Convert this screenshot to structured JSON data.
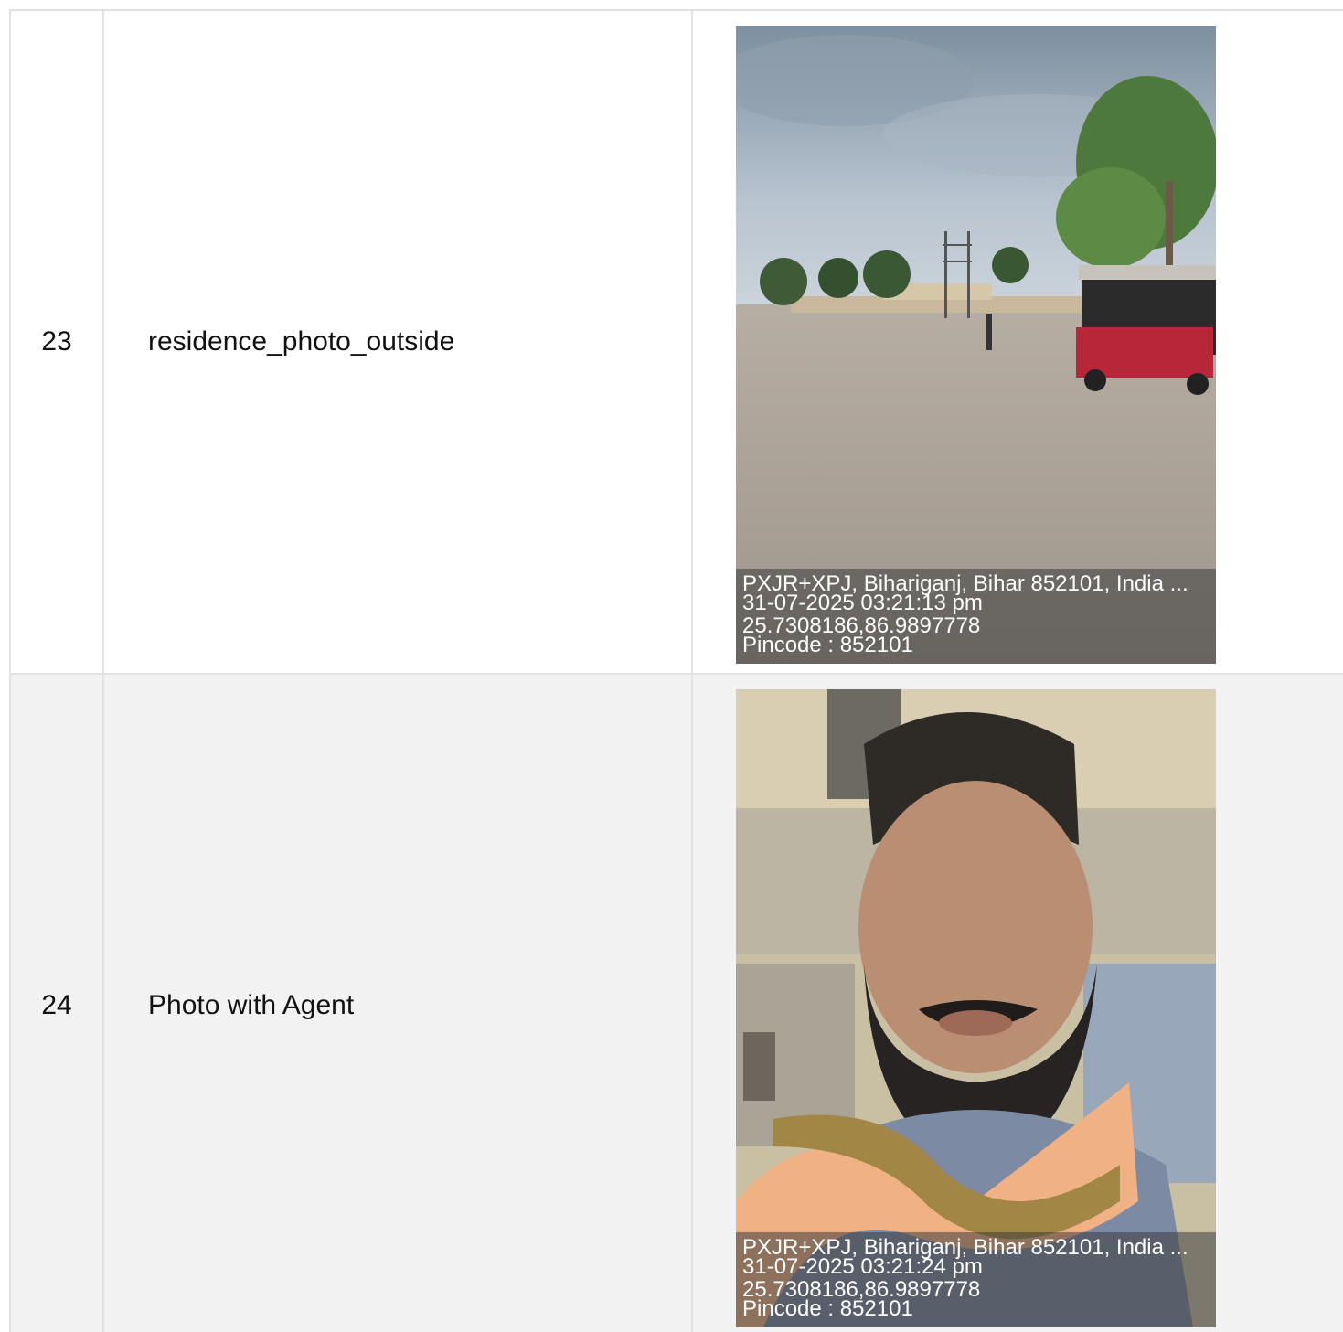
{
  "rows": [
    {
      "number": "23",
      "label": "residence_photo_outside",
      "photo": {
        "subject": "street scene with road, trees, electric pole and red auto-rickshaw",
        "stamp": {
          "address": "PXJR+XPJ, Bihariganj, Bihar 852101, India ...",
          "datetime": "31-07-2025 03:21:13 pm",
          "coordinates": "25.7308186,86.9897778",
          "pincode": "Pincode : 852101"
        }
      }
    },
    {
      "number": "24",
      "label": "Photo with Agent",
      "photo": {
        "subject": "selfie of bearded man with orange scarf in front of building",
        "stamp": {
          "address": "PXJR+XPJ, Bihariganj, Bihar 852101, India ...",
          "datetime": "31-07-2025 03:21:24 pm",
          "coordinates": "25.7308186,86.9897778",
          "pincode": "Pincode : 852101"
        }
      }
    }
  ],
  "colors": {
    "border": "#e2e2e2",
    "alt_row": "#f2f2f2",
    "stamp_background": "rgba(60,60,60,0.55)"
  }
}
